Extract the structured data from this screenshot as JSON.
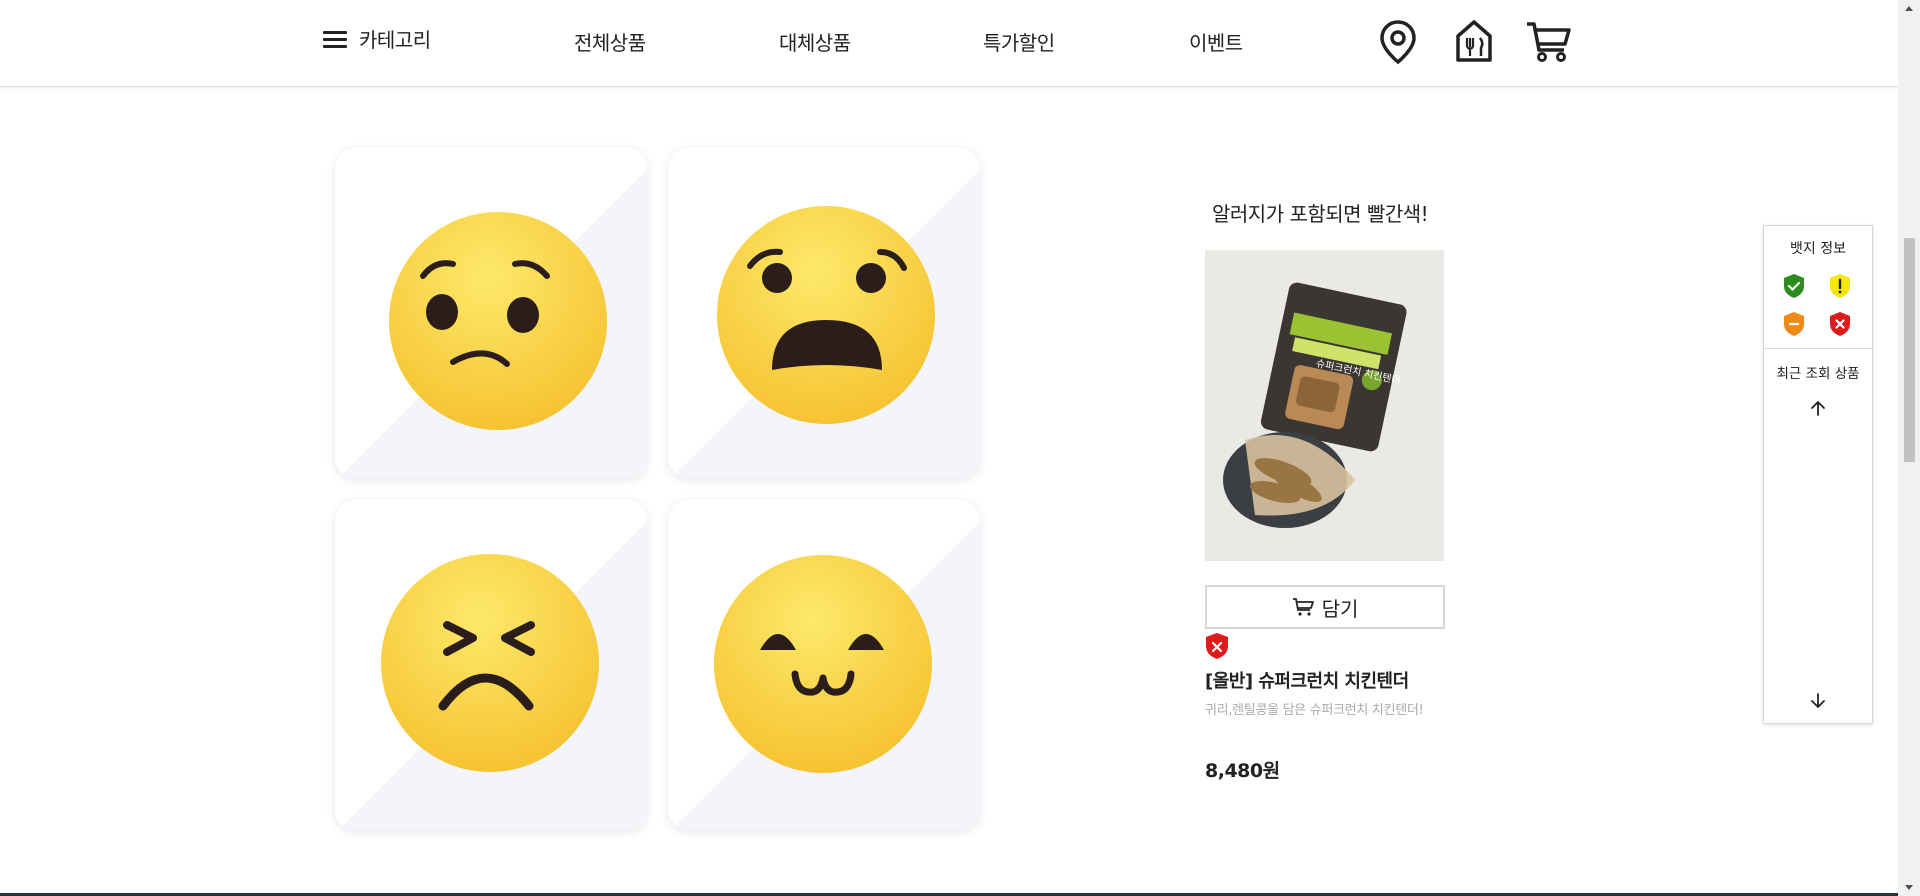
{
  "header": {
    "category_label": "카테고리",
    "nav": [
      "전체상품",
      "대체상품",
      "특가할인",
      "이벤트"
    ],
    "icons": [
      "location-pin-icon",
      "store-icon",
      "cart-icon"
    ]
  },
  "emoji_cards": [
    "worried-face",
    "anguished-face",
    "tired-face",
    "cute-smile-face"
  ],
  "product": {
    "promo_text": "알러지가 포함되면 빨간색!",
    "cart_button_label": "담기",
    "allergy_badge": "red-x-shield",
    "name": "[올반] 슈퍼크런치 치킨텐더",
    "description": "귀리,렌틸콩을 담은 슈퍼크런치 치킨텐더!",
    "price": "8,480원",
    "package_text": "슈퍼크런치 치킨텐더"
  },
  "side_panel": {
    "badge_title": "뱃지 정보",
    "badges": [
      "green-check",
      "yellow-exclamation",
      "orange-minus",
      "red-x"
    ],
    "recent_title": "최근 조회 상품"
  },
  "colors": {
    "emoji_yellow": "#f8cd3b",
    "emoji_feature": "#2b1e1a",
    "badge_green": "#2e8b1e",
    "badge_yellow": "#f5e60a",
    "badge_orange": "#f08a17",
    "badge_red": "#e01b1b"
  }
}
